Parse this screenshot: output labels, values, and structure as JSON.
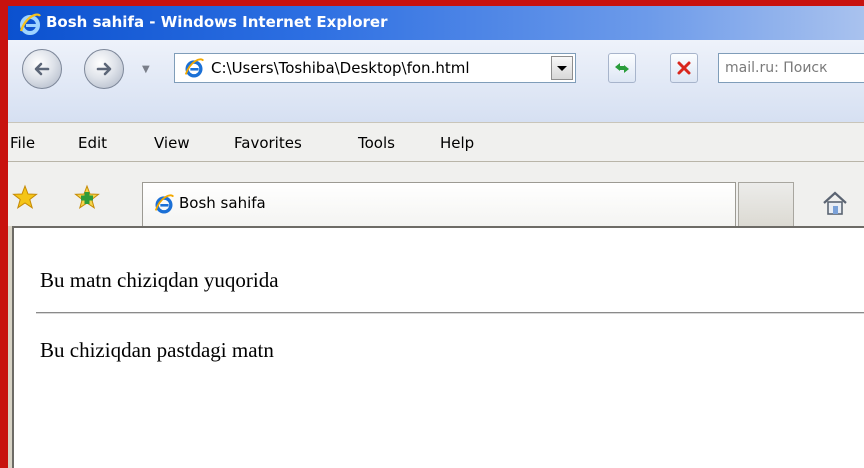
{
  "window": {
    "title": "Bosh sahifa - Windows Internet Explorer"
  },
  "address_bar": {
    "url": "C:\\Users\\Toshiba\\Desktop\\fon.html"
  },
  "search": {
    "placeholder": "mail.ru: Поиск"
  },
  "menu": {
    "items": [
      "File",
      "Edit",
      "View",
      "Favorites",
      "Tools",
      "Help"
    ]
  },
  "tab": {
    "title": "Bosh sahifa"
  },
  "page": {
    "text_above": "Bu matn chiziqdan yuqorida",
    "text_below": "Bu chiziqdan pastdagi matn"
  },
  "icons": {
    "ie": "ie-logo-icon",
    "back": "back-arrow-icon",
    "forward": "forward-arrow-icon",
    "refresh": "refresh-icon",
    "stop": "stop-icon",
    "favorites": "favorites-star-icon",
    "add_favorites": "add-favorites-icon",
    "home": "home-icon"
  },
  "colors": {
    "frame": "#c8120e",
    "titlebar": "#2d6fe2",
    "stop": "#d9261c",
    "refresh": "#2a9d3b"
  }
}
